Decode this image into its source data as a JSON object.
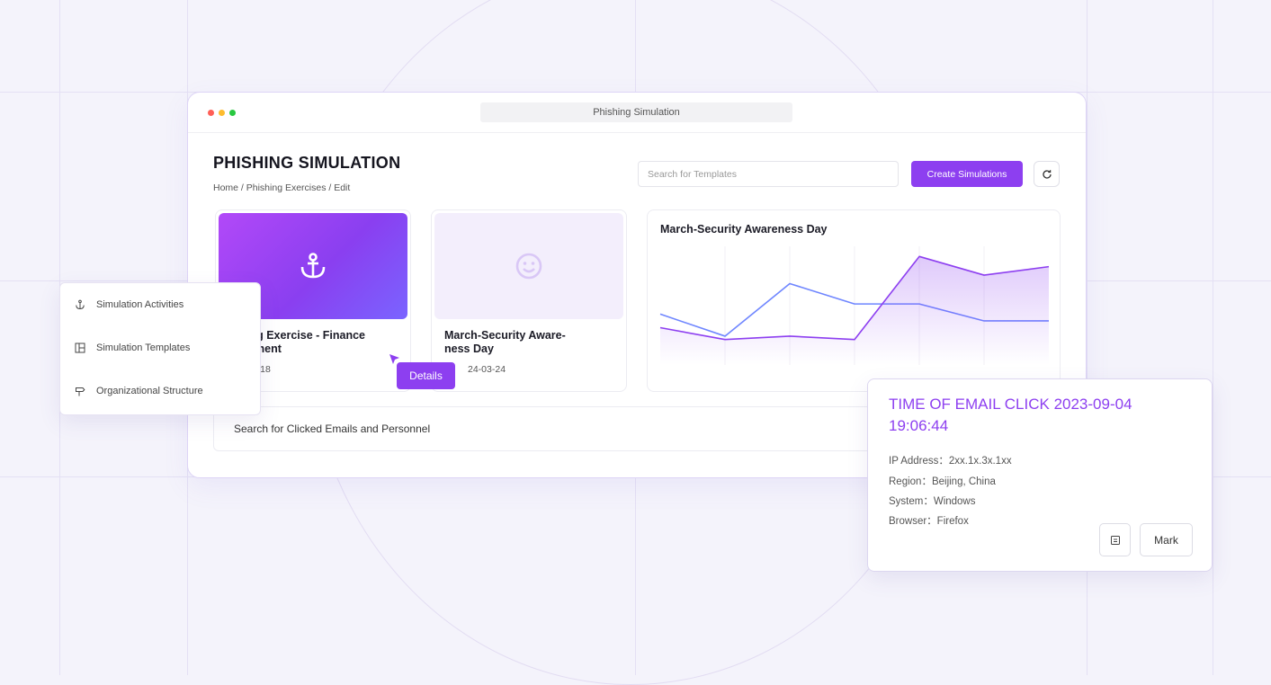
{
  "window": {
    "title": "Phishing Simulation",
    "traffic_lights": [
      "#ff5f57",
      "#febc2e",
      "#28c840"
    ]
  },
  "header": {
    "title": "PHISHING SIMULATION",
    "breadcrumb": "Home / Phishing Exercises / Edit",
    "search_placeholder": "Search for Templates",
    "create_label": "Create Simulations",
    "refresh_icon": "refresh-icon"
  },
  "cards": [
    {
      "title": "Phishing Exercise - Finance Department",
      "title_visible": "ing Exercise - Finance\nrtment",
      "date": "2024-03-18",
      "date_visible": "03-18",
      "icon": "anchor-icon"
    },
    {
      "title": "March-Security Awareness Day",
      "title_visible": "March-Security Aware-\nness Day",
      "date": "2024-03-24",
      "date_visible": "24-03-24",
      "icon": "smiley-icon"
    }
  ],
  "chart": {
    "title": "March-Security Awareness Day"
  },
  "chart_data": {
    "type": "area",
    "title": "March-Security Awareness Day",
    "x": [
      0,
      1,
      2,
      3,
      4,
      5,
      6
    ],
    "series": [
      {
        "values": [
          30,
          17,
          48,
          36,
          36,
          26,
          26
        ],
        "color": "#6f86ff",
        "fill": false
      },
      {
        "values": [
          22,
          15,
          17,
          15,
          64,
          53,
          58
        ],
        "color": "#8d3ff0",
        "fill": true
      }
    ],
    "ylim": [
      0,
      70
    ],
    "grid": true,
    "gridlines": "vertical"
  },
  "search_clicked": "Search for Clicked Emails and Personnel",
  "side_menu": {
    "items": [
      {
        "label": "Simulation Activities",
        "icon": "anchor-icon"
      },
      {
        "label": "Simulation Templates",
        "icon": "template-grid-icon"
      },
      {
        "label": "Organizational Structure",
        "icon": "signpost-icon"
      }
    ]
  },
  "tooltip": {
    "label": "Details"
  },
  "click_info": {
    "title": "TIME OF EMAIL CLICK 2023-09-04 19:06:44",
    "ip": "IP Address：2xx.1x.3x.1xx",
    "region": "Region：Beijing, China",
    "system": "System：Windows",
    "browser": "Browser：Firefox",
    "mark_label": "Mark",
    "note_icon": "note-icon"
  },
  "colors": {
    "accent": "#8d3ff0",
    "accent_blue": "#6f86ff"
  }
}
